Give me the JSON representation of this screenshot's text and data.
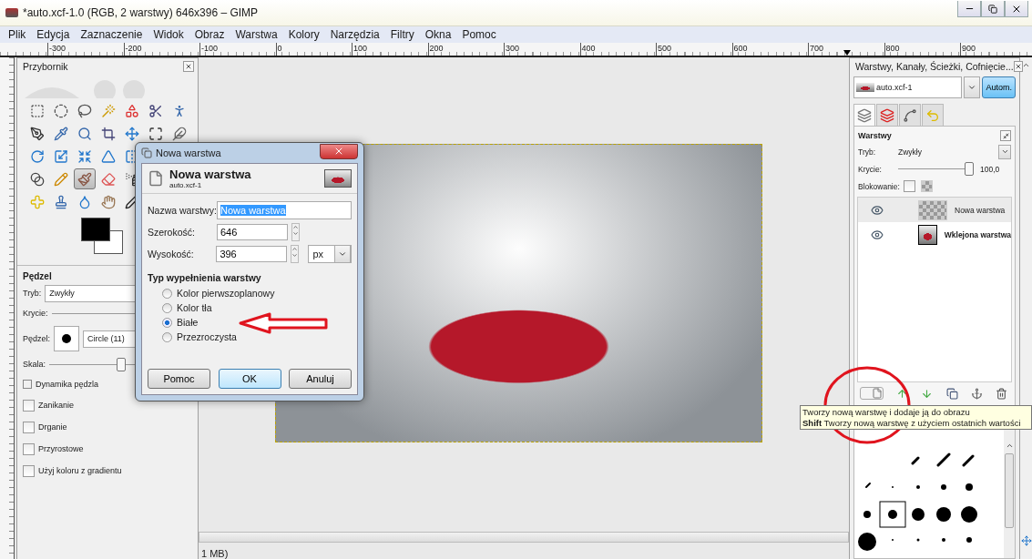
{
  "window": {
    "title": "*auto.xcf-1.0 (RGB, 2 warstwy) 646x396 – GIMP"
  },
  "menu": [
    {
      "label": "Plik"
    },
    {
      "label": "Edycja"
    },
    {
      "label": "Zaznaczenie"
    },
    {
      "label": "Widok"
    },
    {
      "label": "Obraz"
    },
    {
      "label": "Warstwa"
    },
    {
      "label": "Kolory"
    },
    {
      "label": "Narzędzia"
    },
    {
      "label": "Filtry"
    },
    {
      "label": "Okna"
    },
    {
      "label": "Pomoc"
    }
  ],
  "ruler": [
    "-300",
    "-200",
    "-100",
    "0",
    "100",
    "200",
    "300",
    "400",
    "500",
    "600",
    "700",
    "800",
    "900"
  ],
  "toolbox": {
    "title": "Przybornik",
    "tool_rows": [
      [
        {
          "selected": false
        },
        {
          "selected": false
        },
        {
          "selected": false
        },
        {
          "selected": false
        },
        {
          "selected": false
        },
        {
          "selected": false
        },
        {
          "selected": false
        }
      ],
      [
        {
          "selected": false
        },
        {
          "selected": false
        },
        {
          "selected": false
        },
        {
          "selected": false
        },
        {
          "selected": false
        },
        {
          "selected": false
        },
        {
          "selected": false
        }
      ],
      [
        {
          "selected": false
        },
        {
          "selected": false
        },
        {
          "selected": false
        },
        {
          "selected": false
        },
        {
          "selected": false
        }
      ],
      [
        {
          "selected": false
        },
        {
          "selected": false
        },
        {
          "selected": true
        },
        {
          "selected": false
        },
        {
          "selected": false
        }
      ],
      [
        {
          "selected": false
        },
        {
          "selected": false
        },
        {
          "selected": false
        },
        {
          "selected": false
        },
        {
          "selected": false
        }
      ]
    ],
    "options": {
      "title": "Pędzel",
      "mode_label": "Tryb:",
      "mode": "Zwykły",
      "opacity_label": "Krycie:",
      "brush_label": "Pędzel:",
      "brush": "Circle (11)",
      "scale_label": "Skala:",
      "scale_slider": {
        "level": 0.5
      },
      "dynamics": "Dynamika pędzla",
      "checks": [
        {
          "label": "Zanikanie",
          "checked": false
        },
        {
          "label": "Drganie",
          "checked": false
        },
        {
          "label": "Przyrostowe",
          "checked": false
        },
        {
          "label": "Użyj koloru z gradientu",
          "checked": false
        }
      ]
    }
  },
  "dialog": {
    "title": "Nowa warstwa",
    "heading": "Nowa warstwa",
    "subheading": "auto.xcf-1",
    "name_field": {
      "label": "Nazwa warstwy:",
      "value": "Nowa warstwa"
    },
    "width_field": {
      "label": "Szerokość:",
      "value": "646"
    },
    "height_field": {
      "label": "Wysokość:",
      "value": "396"
    },
    "unit": "px",
    "fill_title": "Typ wypełnienia warstwy",
    "fill_options": [
      {
        "label": "Kolor pierwszoplanowy",
        "selected": false
      },
      {
        "label": "Kolor tła",
        "selected": false
      },
      {
        "label": "Białe",
        "selected": true
      },
      {
        "label": "Przezroczysta",
        "selected": false
      }
    ],
    "buttons": [
      {
        "label": "Pomoc",
        "default": false
      },
      {
        "label": "OK",
        "default": true
      },
      {
        "label": "Anuluj",
        "default": false
      }
    ]
  },
  "dock": {
    "title": "Warstwy, Kanały, Ścieżki, Cofnięcie...",
    "image": "auto.xcf-1",
    "auto_button": "Autom.",
    "tabs": [
      {
        "selected": true
      },
      {
        "selected": false
      },
      {
        "selected": false
      },
      {
        "selected": false
      }
    ],
    "panel_title": "Warstwy",
    "mode_label": "Tryb:",
    "mode": "Zwykły",
    "opacity_label": "Krycie:",
    "opacity": "100,0",
    "opacity_slider": {
      "level": 1
    },
    "lock_label": "Blokowanie:",
    "lock_checked": false,
    "layers": [
      {
        "name": "Nowa warstwa",
        "visible": true,
        "selected": true,
        "floating": false,
        "kind": "transparent"
      },
      {
        "name": "Wklejona warstwa",
        "visible": true,
        "selected": false,
        "floating": true,
        "kind": "photo"
      }
    ]
  },
  "tooltip": {
    "line1": "Tworzy nową warstwę i dodaje ją do obrazu",
    "line2": "**Shift**  Tworzy nową warstwę z użyciem ostatnich wartości"
  },
  "status": "1 MB)"
}
